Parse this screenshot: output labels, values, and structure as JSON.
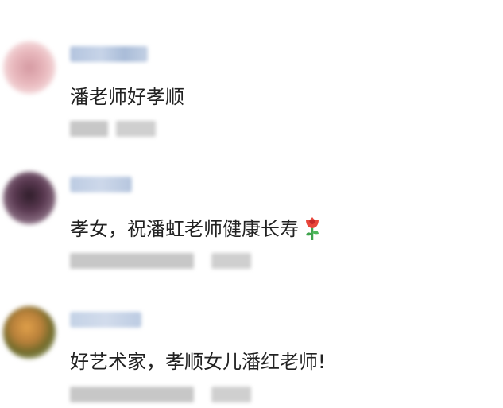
{
  "comments": [
    {
      "text": "潘老师好孝顺",
      "avatar_color": "#e6b3b8",
      "name_color": "#aec0da"
    },
    {
      "text": "孝女，祝潘虹老师健康长寿",
      "emoji": "rose-emoji",
      "avatar_color": "#4a3040",
      "name_color": "#b8c8e0"
    },
    {
      "text": "好艺术家，孝顺女儿潘红老师!",
      "avatar_color": "#7a6a30",
      "name_color": "#b8c8e0"
    }
  ]
}
